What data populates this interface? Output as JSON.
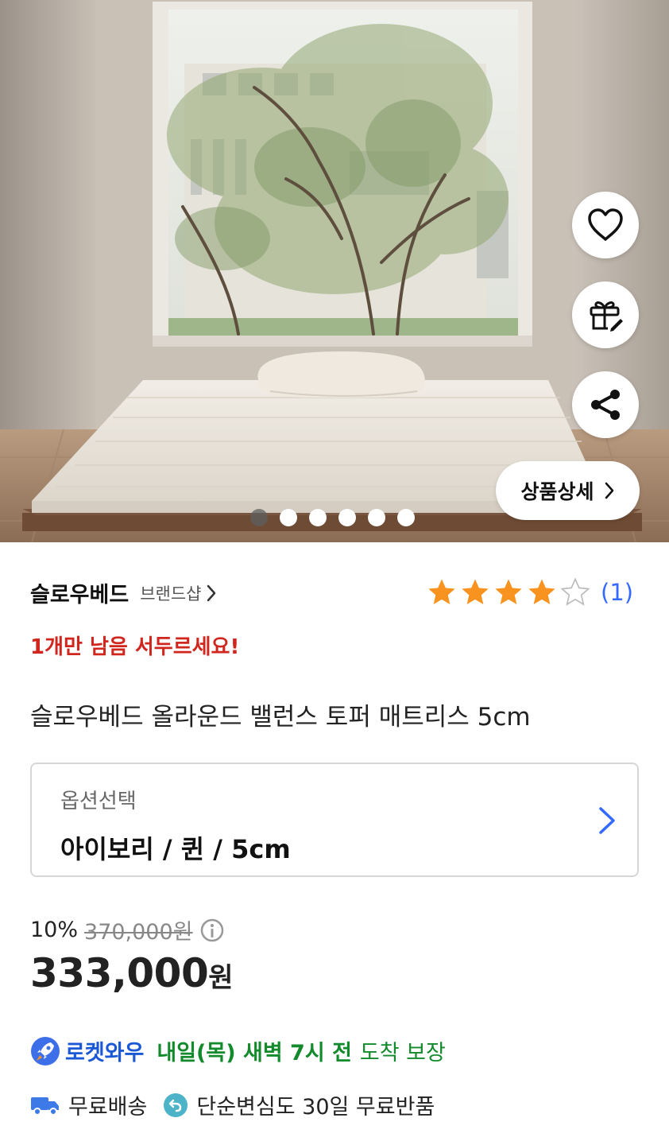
{
  "hero": {
    "image_alt": "mattress on bed frame in front of large window",
    "slide_count": 6,
    "active_slide": 1,
    "detail_label": "상품상세",
    "icons": [
      "heart-icon",
      "gift-icon",
      "share-icon",
      "chevron-right-icon"
    ]
  },
  "brand": {
    "name": "슬로우베드",
    "shop_label": "브랜드샵"
  },
  "rating": {
    "stars": 4,
    "max_stars": 5,
    "count": "(1)",
    "star_color": "#f7931e",
    "count_color": "#346aff"
  },
  "urgent": "1개만 남음 서두르세요!",
  "product_title": "슬로우베드 올라운드 밸런스 토퍼 매트리스 5cm",
  "option": {
    "label": "옵션선택",
    "value": "아이보리 / 퀸 / 5cm"
  },
  "price": {
    "discount": "10%",
    "original": "370,000원",
    "sale_number": "333,000",
    "sale_unit": "원"
  },
  "delivery": {
    "rocket_label": "로켓와우",
    "arrival_time": "내일(목) 새벽 7시 전",
    "guarantee": "도착 보장",
    "free_shipping": "무료배송",
    "free_return": "단순변심도 30일 무료반품",
    "rocket_color": "#1a58d6",
    "time_color": "#138a2b"
  }
}
